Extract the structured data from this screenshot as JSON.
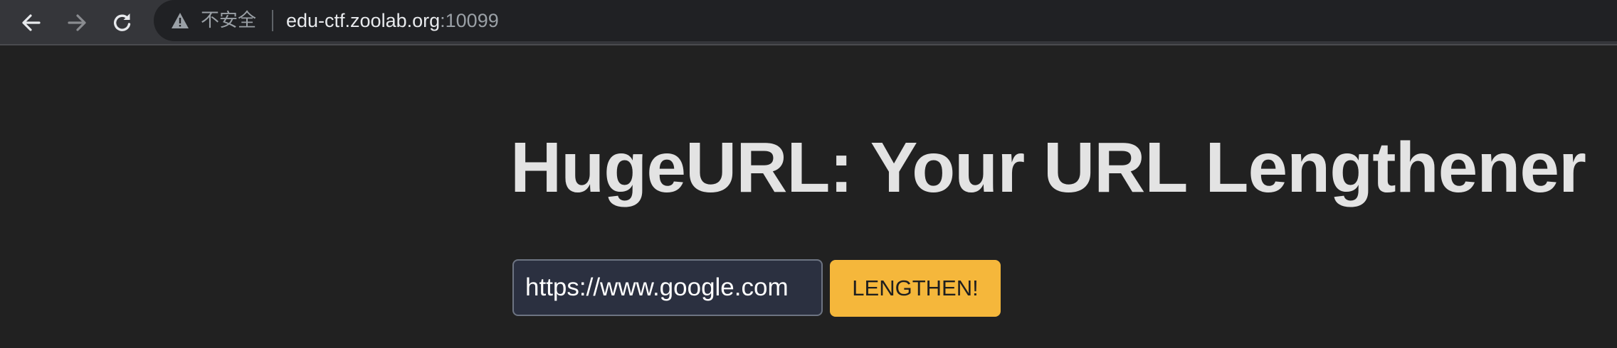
{
  "browser": {
    "security_label": "不安全",
    "url_host": "edu-ctf.zoolab.org",
    "url_port": ":10099",
    "icons": {
      "back": "arrow-left-icon",
      "forward": "arrow-right-icon",
      "reload": "reload-icon",
      "security": "warning-triangle-icon"
    }
  },
  "page": {
    "heading": "HugeURL: Your URL Lengthener",
    "url_input_value": "https://www.google.com",
    "button_label": "LENGTHEN!",
    "colors": {
      "background": "#212121",
      "heading": "#e3e3e3",
      "button": "#f5b73b",
      "input_background": "#2b3040"
    }
  }
}
